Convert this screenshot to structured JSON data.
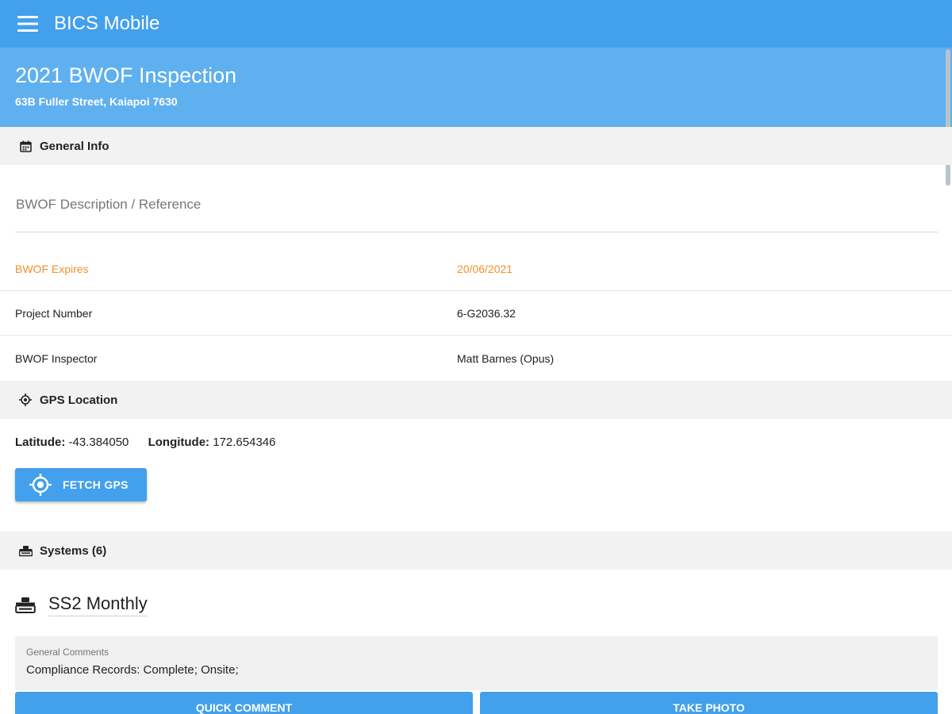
{
  "app": {
    "title": "BICS Mobile",
    "menu_icon": "hamburger-menu-icon"
  },
  "inspection": {
    "title": "2021 BWOF Inspection",
    "address": "63B Fuller Street, Kaiapoi 7630"
  },
  "general_info": {
    "header": "General Info",
    "icon": "calendar-icon",
    "description_placeholder": "BWOF Description / Reference",
    "rows": [
      {
        "label": "BWOF Expires",
        "value": "20/06/2021",
        "status_color": "#f0922e"
      },
      {
        "label": "Project Number",
        "value": "6-G2036.32"
      },
      {
        "label": "BWOF Inspector",
        "value": "Matt Barnes (Opus)"
      }
    ]
  },
  "gps": {
    "header": "GPS Location",
    "icon": "crosshair-icon",
    "latitude_label": "Latitude:",
    "latitude": "-43.384050",
    "longitude_label": "Longitude:",
    "longitude": "172.654346",
    "fetch_button": "FETCH GPS"
  },
  "systems": {
    "header": "Systems (6)",
    "icon": "fire-truck-icon",
    "items": [
      {
        "name": "SS2 Monthly",
        "comments_label": "General Comments",
        "comments": "Compliance Records: Complete; Onsite;",
        "quick_comment_button": "QUICK COMMENT",
        "take_photo_button": "TAKE PHOTO"
      }
    ]
  },
  "colors": {
    "primary": "#42a0ec",
    "primary_light": "#5fb0ef",
    "warning": "#f0922e",
    "section_bg": "#f2f2f2"
  }
}
